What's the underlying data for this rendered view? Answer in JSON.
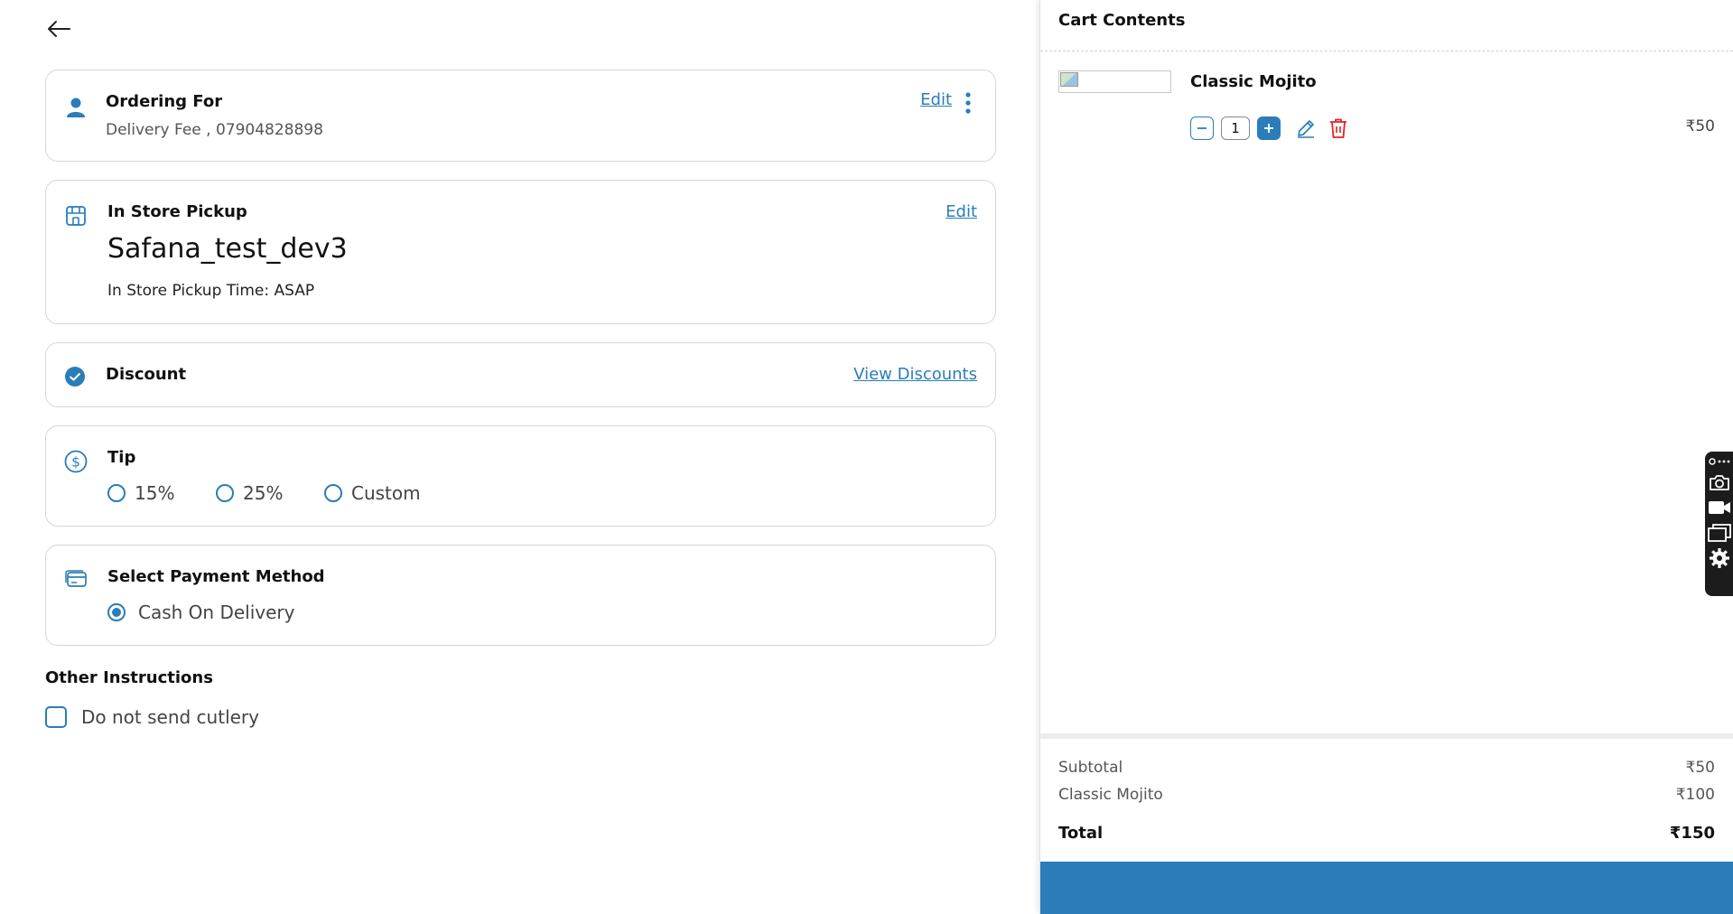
{
  "ordering": {
    "title": "Ordering For",
    "subtitle": "Delivery Fee , 07904828898",
    "edit_label": "Edit"
  },
  "pickup": {
    "title": "In Store Pickup",
    "store_name": "Safana_test_dev3",
    "time_text": "In Store Pickup Time: ASAP",
    "edit_label": "Edit"
  },
  "discount": {
    "title": "Discount",
    "view_label": "View Discounts"
  },
  "tip": {
    "title": "Tip",
    "options": [
      "15%",
      "25%",
      "Custom"
    ],
    "selected": null
  },
  "payment": {
    "title": "Select Payment Method",
    "option": "Cash On Delivery",
    "selected": true
  },
  "instructions": {
    "title": "Other Instructions",
    "cutlery_label": "Do not send cutlery",
    "cutlery_checked": false
  },
  "cart": {
    "title": "Cart Contents",
    "items": [
      {
        "name": "Classic Mojito",
        "quantity": "1",
        "price": "₹50"
      }
    ],
    "summary": {
      "subtotal_label": "Subtotal",
      "subtotal_value": "₹50",
      "line_label": "Classic Mojito",
      "line_value": "₹100",
      "total_label": "Total",
      "total_value": "₹150"
    }
  },
  "colors": {
    "accent": "#2a7db8",
    "danger": "#e02424",
    "border": "#d6d6d6"
  },
  "icons": {
    "back": "arrow-left-icon",
    "user": "user-icon",
    "store": "store-icon",
    "discount": "check-circle-icon",
    "tip": "dollar-circle-icon",
    "payment": "card-icon",
    "more": "more-vertical-icon",
    "edit": "pencil-icon",
    "delete": "trash-icon"
  }
}
